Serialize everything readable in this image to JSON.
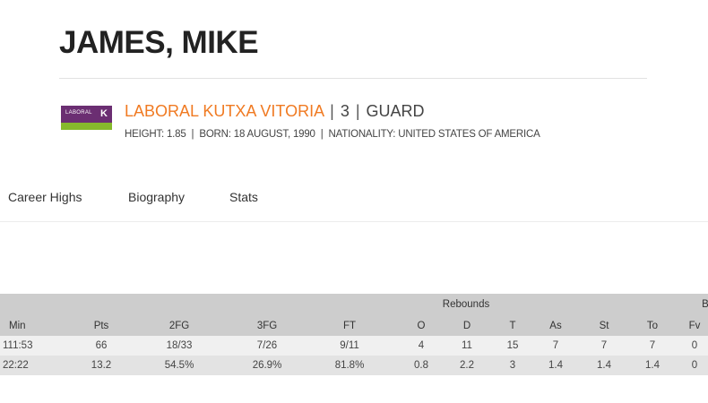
{
  "player": {
    "name": "JAMES, MIKE",
    "team": "LABORAL KUTXA VITORIA",
    "number": "3",
    "position": "GUARD",
    "info": {
      "height": "HEIGHT: 1.85",
      "born": "BORN: 18 AUGUST, 1990",
      "nationality": "NATIONALITY: UNITED STATES OF AMERICA"
    },
    "logo": {
      "text": "LABORAL",
      "mark": "K",
      "colors": {
        "purple": "#6b2e72",
        "green": "#86b92c"
      }
    }
  },
  "colors": {
    "accent": "#f07a22"
  },
  "tabs": [
    "Career Highs",
    "Biography",
    "Stats"
  ],
  "stats_table": {
    "group_header": {
      "rebounds": "Rebounds",
      "overflow": "B"
    },
    "columns": [
      "Min",
      "Pts",
      "2FG",
      "3FG",
      "FT",
      "O",
      "D",
      "T",
      "As",
      "St",
      "To",
      "Fv"
    ],
    "rows": [
      [
        "111:53",
        "66",
        "18/33",
        "7/26",
        "9/11",
        "4",
        "11",
        "15",
        "7",
        "7",
        "7",
        "0"
      ],
      [
        "22:22",
        "13.2",
        "54.5%",
        "26.9%",
        "81.8%",
        "0.8",
        "2.2",
        "3",
        "1.4",
        "1.4",
        "1.4",
        "0"
      ]
    ]
  }
}
